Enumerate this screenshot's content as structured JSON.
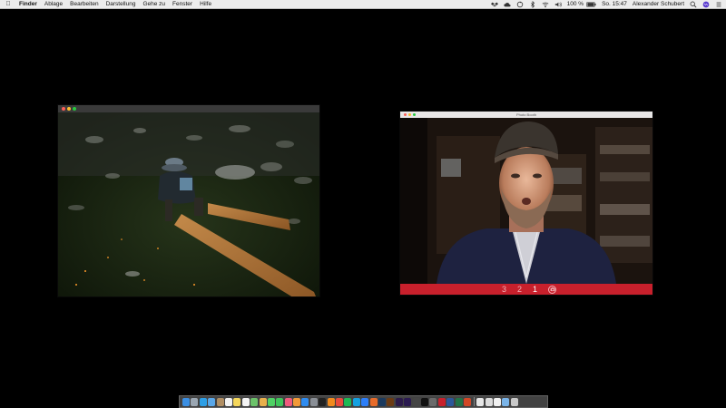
{
  "menubar": {
    "app_name": "Finder",
    "items": [
      "Ablage",
      "Bearbeiten",
      "Darstellung",
      "Gehe zu",
      "Fenster",
      "Hilfe"
    ],
    "battery": "100 %",
    "clock": "So. 15:47",
    "user": "Alexander Schubert",
    "status_icons": [
      "dropbox-icon",
      "cloud-icon",
      "sync-icon",
      "bluetooth-icon",
      "wifi-icon",
      "volume-icon",
      "battery-icon",
      "search-icon",
      "siri-icon",
      "notification-icon"
    ]
  },
  "photo_window": {
    "traffic_lights": [
      "close",
      "minimize",
      "zoom"
    ]
  },
  "booth_window": {
    "title": "Photo Booth",
    "countdown": [
      "3",
      "2",
      "1"
    ],
    "current_count": "1",
    "bar_color": "#c8202c"
  },
  "dock": {
    "apps": [
      {
        "name": "finder-icon",
        "color": "#3b8fe3"
      },
      {
        "name": "launchpad-icon",
        "color": "#9aa6b2"
      },
      {
        "name": "safari-icon",
        "color": "#2e9fe6"
      },
      {
        "name": "mail-icon",
        "color": "#5aa7e8"
      },
      {
        "name": "contacts-icon",
        "color": "#b08e63"
      },
      {
        "name": "calendar-icon",
        "color": "#f2f2f2"
      },
      {
        "name": "notes-icon",
        "color": "#f5d75c"
      },
      {
        "name": "reminders-icon",
        "color": "#f4f4f4"
      },
      {
        "name": "maps-icon",
        "color": "#6cc26a"
      },
      {
        "name": "photos-icon",
        "color": "#e8b04c"
      },
      {
        "name": "messages-icon",
        "color": "#4fd164"
      },
      {
        "name": "facetime-icon",
        "color": "#3fc55a"
      },
      {
        "name": "music-icon",
        "color": "#f05a7e"
      },
      {
        "name": "books-icon",
        "color": "#f29a38"
      },
      {
        "name": "appstore-icon",
        "color": "#2f8cf0"
      },
      {
        "name": "preferences-icon",
        "color": "#8a8f96"
      },
      {
        "name": "terminal-icon",
        "color": "#222222"
      },
      {
        "name": "vlc-icon",
        "color": "#f08a1e"
      },
      {
        "name": "chrome-icon",
        "color": "#e94b3c"
      },
      {
        "name": "spotify-icon",
        "color": "#1db954"
      },
      {
        "name": "skype-icon",
        "color": "#14a0e0"
      },
      {
        "name": "dropbox-app-icon",
        "color": "#2d7ff9"
      },
      {
        "name": "firefox-icon",
        "color": "#e76b2a"
      },
      {
        "name": "photoshop-icon",
        "color": "#1b3a5e"
      },
      {
        "name": "illustrator-icon",
        "color": "#6b3a12"
      },
      {
        "name": "premiere-icon",
        "color": "#2b1a4a"
      },
      {
        "name": "aftereffects-icon",
        "color": "#2a1a50"
      },
      {
        "name": "max-icon",
        "color": "#444444"
      },
      {
        "name": "ableton-icon",
        "color": "#111111"
      },
      {
        "name": "reaper-icon",
        "color": "#6a6a6a"
      },
      {
        "name": "photobooth-icon",
        "color": "#c8202c"
      },
      {
        "name": "word-icon",
        "color": "#2b579a"
      },
      {
        "name": "excel-icon",
        "color": "#217346"
      },
      {
        "name": "powerpoint-icon",
        "color": "#d24726"
      }
    ],
    "docs": [
      {
        "name": "document-icon",
        "color": "#e6e6e6"
      },
      {
        "name": "document-icon",
        "color": "#dcdcdc"
      },
      {
        "name": "document-icon",
        "color": "#f0f0f0"
      },
      {
        "name": "downloads-icon",
        "color": "#7ab4e8"
      },
      {
        "name": "trash-icon",
        "color": "#c9c9c9"
      }
    ]
  }
}
